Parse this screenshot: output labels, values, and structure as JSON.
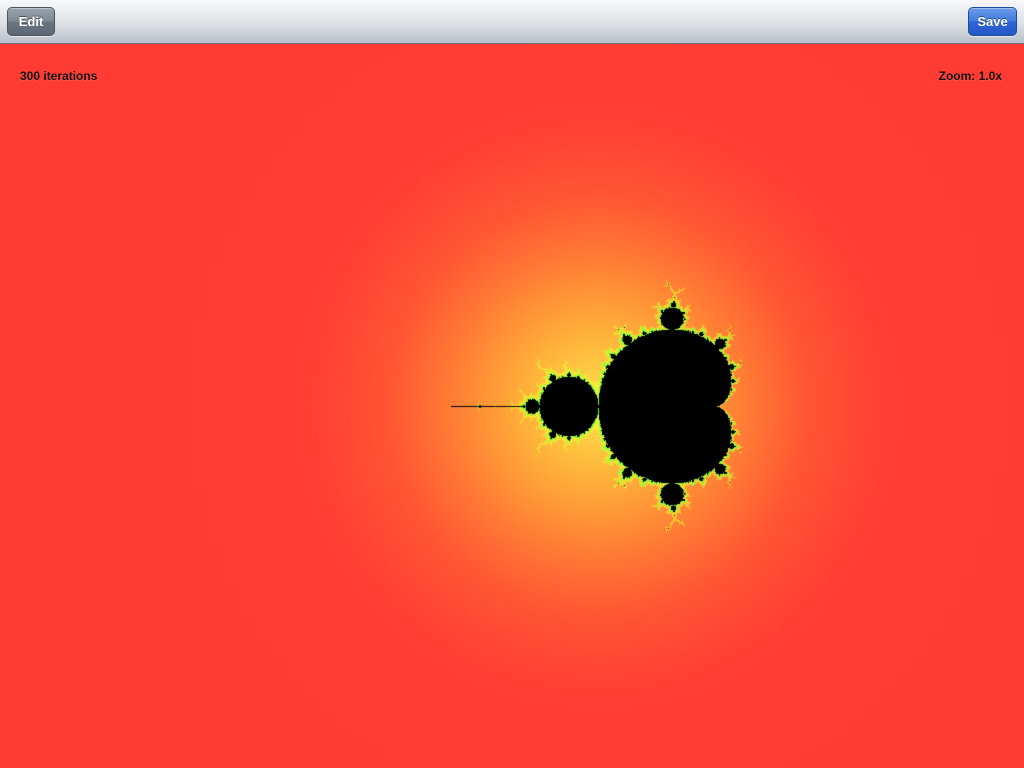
{
  "toolbar": {
    "edit_label": "Edit",
    "save_label": "Save"
  },
  "status": {
    "iterations": "300 iterations",
    "zoom": "Zoom: 1.0x"
  },
  "fractal": {
    "type": "mandelbrot",
    "max_iterations": 300,
    "zoom": 1.0,
    "center_re": -0.75,
    "center_im": 0.0,
    "colors": {
      "background": "#ff3c33",
      "glow": "#ffe34a",
      "edge": "#7dff3a",
      "set": "#000000"
    }
  }
}
